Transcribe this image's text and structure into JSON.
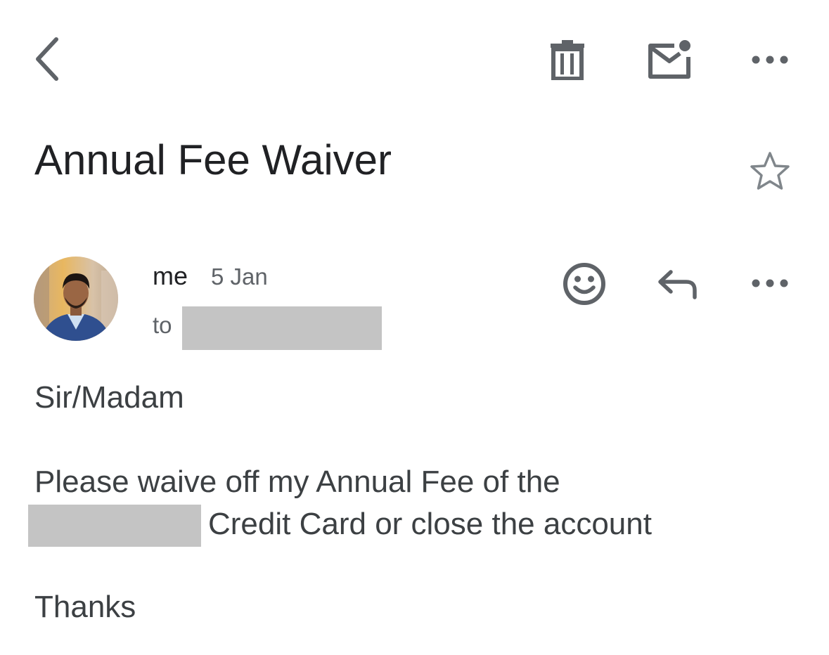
{
  "toolbar": {
    "back_icon": "chevron-left-icon",
    "delete_icon": "trash-icon",
    "mark_unread_icon": "mail-unread-icon",
    "more_icon": "more-horizontal-icon",
    "icon_color": "#5f6368"
  },
  "email": {
    "subject": "Annual Fee Waiver",
    "starred": false,
    "sender": {
      "name": "me",
      "date": "5 Jan",
      "to_label": "to",
      "recipient_redacted": true
    },
    "actions": {
      "emoji_icon": "emoji-smile-icon",
      "reply_icon": "reply-icon",
      "more_icon": "more-horizontal-icon"
    },
    "body": {
      "greeting": "Sir/Madam",
      "line1": "Please waive off my Annual Fee of the",
      "line2": "Credit Card or close the account",
      "signoff": "Thanks"
    }
  },
  "colors": {
    "text_primary": "#202124",
    "text_secondary": "#5f6368",
    "body_text": "#3c4043",
    "redaction": "#c4c4c4"
  }
}
